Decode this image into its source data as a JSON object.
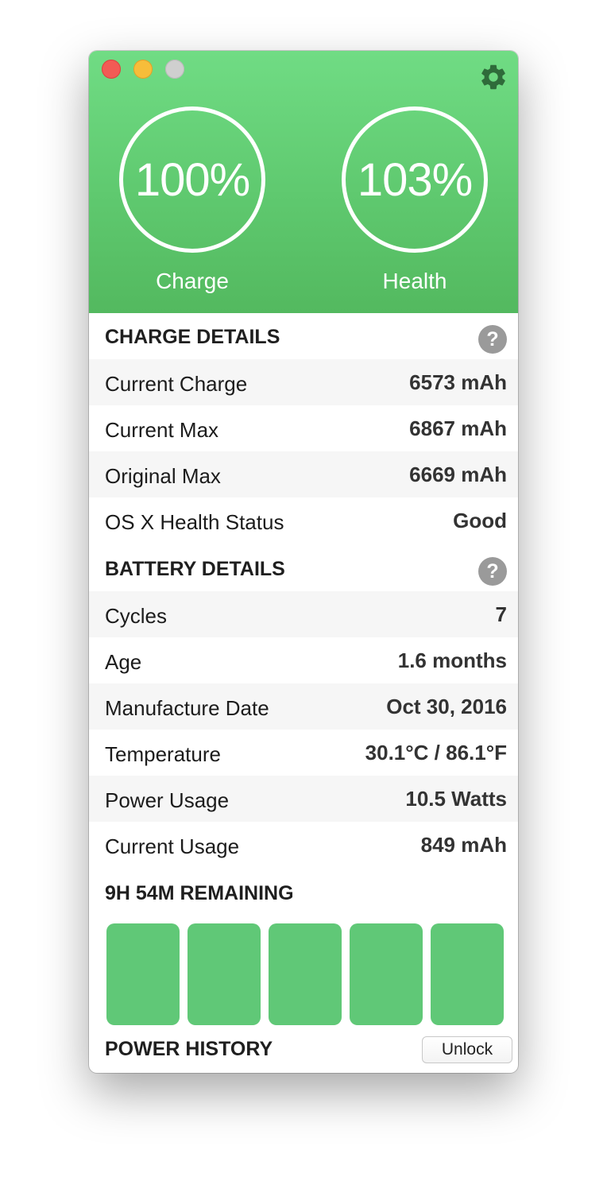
{
  "header": {
    "charge_value": "100%",
    "charge_label": "Charge",
    "health_value": "103%",
    "health_label": "Health"
  },
  "charge_details": {
    "title": "CHARGE DETAILS",
    "help": "?",
    "rows": [
      {
        "label": "Current Charge",
        "value": "6573 mAh"
      },
      {
        "label": "Current Max",
        "value": "6867 mAh"
      },
      {
        "label": "Original Max",
        "value": "6669 mAh"
      },
      {
        "label": "OS X Health Status",
        "value": "Good"
      }
    ]
  },
  "battery_details": {
    "title": "BATTERY DETAILS",
    "help": "?",
    "rows": [
      {
        "label": "Cycles",
        "value": "7"
      },
      {
        "label": "Age",
        "value": "1.6 months"
      },
      {
        "label": "Manufacture Date",
        "value": "Oct 30, 2016"
      },
      {
        "label": "Temperature",
        "value": "30.1°C / 86.1°F"
      },
      {
        "label": "Power Usage",
        "value": "10.5 Watts"
      },
      {
        "label": "Current Usage",
        "value": "849 mAh"
      }
    ]
  },
  "remaining": {
    "title": "9H 54M REMAINING",
    "bars_filled": 5,
    "bars_total": 5
  },
  "power_history": {
    "title": "POWER HISTORY",
    "unlock_label": "Unlock"
  },
  "colors": {
    "accent": "#5fc96f",
    "bar": "#60c877",
    "close": "#f25b55",
    "minimize": "#f7bd3a",
    "zoom": "#cfcfcf",
    "gear": "#2f6b3a"
  },
  "icons": {
    "settings": "gear-icon",
    "help": "help-icon"
  }
}
